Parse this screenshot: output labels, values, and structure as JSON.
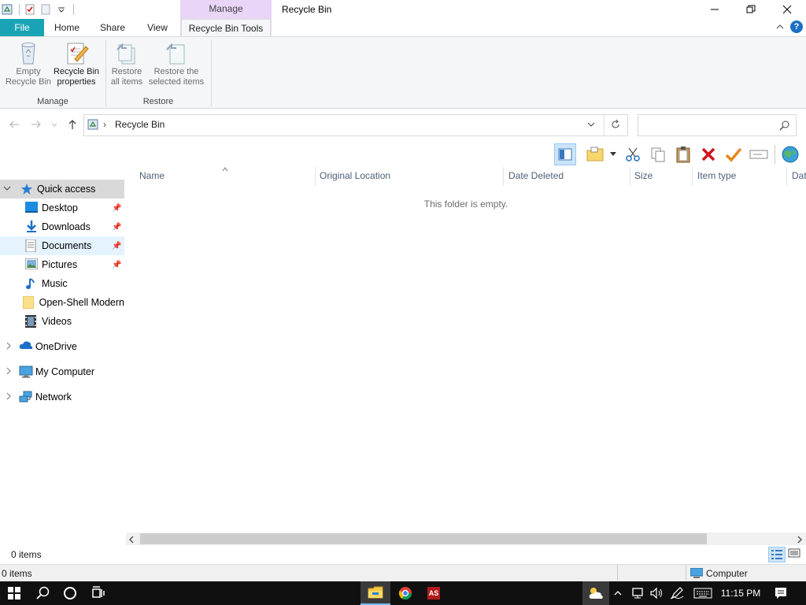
{
  "window": {
    "title": "Recycle Bin",
    "context_tab_group": "Manage"
  },
  "ribbon": {
    "tabs": [
      "File",
      "Home",
      "Share",
      "View",
      "Recycle Bin Tools"
    ],
    "buttons": {
      "empty_line1": "Empty",
      "empty_line2": "Recycle Bin",
      "props_line1": "Recycle Bin",
      "props_line2": "properties",
      "restore_all_line1": "Restore",
      "restore_all_line2": "all items",
      "restore_sel_line1": "Restore the",
      "restore_sel_line2": "selected items"
    },
    "groups": [
      "Manage",
      "Restore"
    ]
  },
  "address": {
    "path": "Recycle Bin",
    "search_placeholder": ""
  },
  "navpane": {
    "quick_access": "Quick access",
    "items": [
      {
        "label": "Desktop",
        "pinned": true,
        "icon": "desktop-icon"
      },
      {
        "label": "Downloads",
        "pinned": true,
        "icon": "downloads-icon"
      },
      {
        "label": "Documents",
        "pinned": true,
        "icon": "documents-icon"
      },
      {
        "label": "Pictures",
        "pinned": true,
        "icon": "pictures-icon"
      },
      {
        "label": "Music",
        "pinned": false,
        "icon": "music-icon"
      },
      {
        "label": "Open-Shell Modern",
        "pinned": false,
        "icon": "folder-icon"
      },
      {
        "label": "Videos",
        "pinned": false,
        "icon": "videos-icon"
      }
    ],
    "roots": [
      "OneDrive",
      "My Computer",
      "Network"
    ]
  },
  "content": {
    "columns": [
      "Name",
      "Original Location",
      "Date Deleted",
      "Size",
      "Item type",
      "Dat"
    ],
    "empty_message": "This folder is empty."
  },
  "status": {
    "items_inner": "0 items",
    "items_outer": "0 items",
    "location": "Computer"
  },
  "taskbar": {
    "clock": "11:15 PM"
  },
  "colors": {
    "file_tab": "#19a3b5",
    "context_tab": "#e8d5f7",
    "selection": "#e5f3ff"
  }
}
